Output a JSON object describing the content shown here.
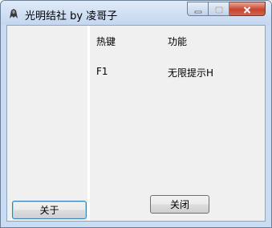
{
  "window": {
    "title": "光明结社 by 凌哥子"
  },
  "caption": {
    "minimize_icon": "minimize-icon",
    "maximize_icon": "maximize-icon",
    "close_icon": "close-icon",
    "close_color": "#c7442f"
  },
  "left_panel": {
    "about_label": "关于"
  },
  "hotkeys": {
    "headers": [
      "热键",
      "功能"
    ],
    "rows": [
      {
        "key": "F1",
        "function": "无限提示H"
      }
    ]
  },
  "footer": {
    "close_label": "关闭"
  }
}
